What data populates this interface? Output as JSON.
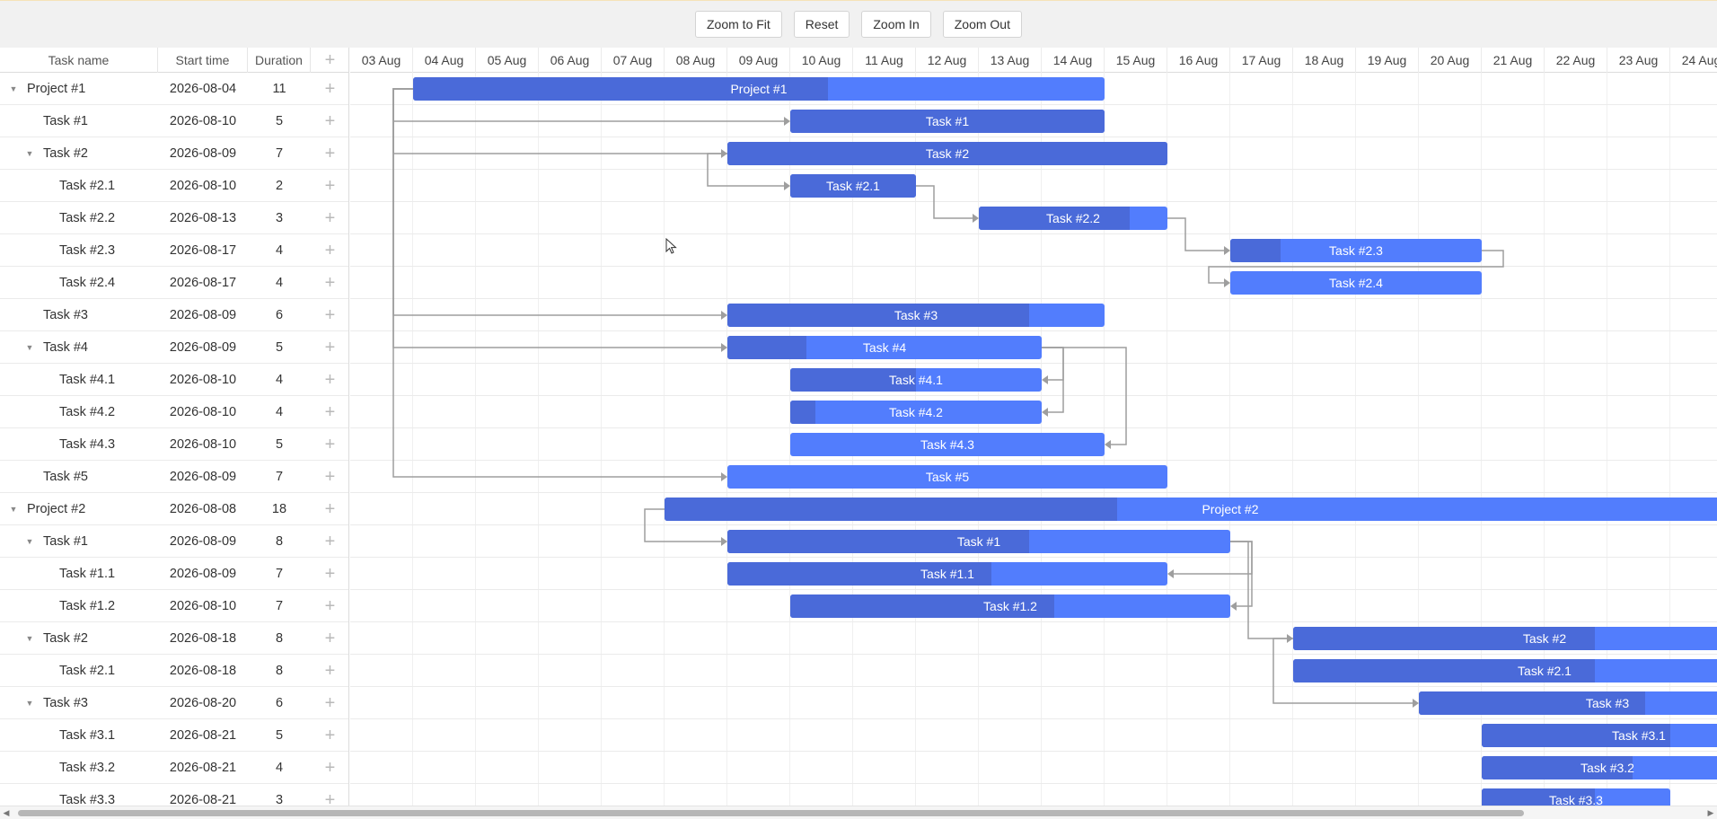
{
  "toolbar": {
    "buttons": [
      {
        "id": "zoom-to-fit",
        "label": "Zoom to Fit"
      },
      {
        "id": "reset",
        "label": "Reset"
      },
      {
        "id": "zoom-in",
        "label": "Zoom In"
      },
      {
        "id": "zoom-out",
        "label": "Zoom Out"
      }
    ]
  },
  "grid": {
    "columns": {
      "name": "Task name",
      "start": "Start time",
      "duration": "Duration",
      "add": "+"
    }
  },
  "scale": {
    "days": [
      "03 Aug",
      "04 Aug",
      "05 Aug",
      "06 Aug",
      "07 Aug",
      "08 Aug",
      "09 Aug",
      "10 Aug",
      "11 Aug",
      "12 Aug",
      "13 Aug",
      "14 Aug",
      "15 Aug",
      "16 Aug",
      "17 Aug",
      "18 Aug",
      "19 Aug",
      "20 Aug",
      "21 Aug",
      "22 Aug",
      "23 Aug",
      "24 Aug"
    ]
  },
  "tasks": [
    {
      "id": "p1",
      "name": "Project #1",
      "start": "2026-08-04",
      "duration": "11",
      "level": 0,
      "toggle": true,
      "bar_start": "2026-08-04",
      "bar_days": 11,
      "progress": 0.6
    },
    {
      "id": "p1t1",
      "name": "Task #1",
      "start": "2026-08-10",
      "duration": "5",
      "level": 1,
      "toggle": false,
      "bar_start": "2026-08-10",
      "bar_days": 5,
      "progress": 1.0
    },
    {
      "id": "p1t2",
      "name": "Task #2",
      "start": "2026-08-09",
      "duration": "7",
      "level": 1,
      "toggle": true,
      "bar_start": "2026-08-09",
      "bar_days": 7,
      "progress": 1.0
    },
    {
      "id": "p1t21",
      "name": "Task #2.1",
      "start": "2026-08-10",
      "duration": "2",
      "level": 2,
      "toggle": false,
      "bar_start": "2026-08-10",
      "bar_days": 2,
      "progress": 1.0
    },
    {
      "id": "p1t22",
      "name": "Task #2.2",
      "start": "2026-08-13",
      "duration": "3",
      "level": 2,
      "toggle": false,
      "bar_start": "2026-08-13",
      "bar_days": 3,
      "progress": 0.8
    },
    {
      "id": "p1t23",
      "name": "Task #2.3",
      "start": "2026-08-17",
      "duration": "4",
      "level": 2,
      "toggle": false,
      "bar_start": "2026-08-17",
      "bar_days": 4,
      "progress": 0.2
    },
    {
      "id": "p1t24",
      "name": "Task #2.4",
      "start": "2026-08-17",
      "duration": "4",
      "level": 2,
      "toggle": false,
      "bar_start": "2026-08-17",
      "bar_days": 4,
      "progress": 0
    },
    {
      "id": "p1t3",
      "name": "Task #3",
      "start": "2026-08-09",
      "duration": "6",
      "level": 1,
      "toggle": false,
      "bar_start": "2026-08-09",
      "bar_days": 6,
      "progress": 0.8
    },
    {
      "id": "p1t4",
      "name": "Task #4",
      "start": "2026-08-09",
      "duration": "5",
      "level": 1,
      "toggle": true,
      "bar_start": "2026-08-09",
      "bar_days": 5,
      "progress": 0.25
    },
    {
      "id": "p1t41",
      "name": "Task #4.1",
      "start": "2026-08-10",
      "duration": "4",
      "level": 2,
      "toggle": false,
      "bar_start": "2026-08-10",
      "bar_days": 4,
      "progress": 0.5
    },
    {
      "id": "p1t42",
      "name": "Task #4.2",
      "start": "2026-08-10",
      "duration": "4",
      "level": 2,
      "toggle": false,
      "bar_start": "2026-08-10",
      "bar_days": 4,
      "progress": 0.1
    },
    {
      "id": "p1t43",
      "name": "Task #4.3",
      "start": "2026-08-10",
      "duration": "5",
      "level": 2,
      "toggle": false,
      "bar_start": "2026-08-10",
      "bar_days": 5,
      "progress": 0
    },
    {
      "id": "p1t5",
      "name": "Task #5",
      "start": "2026-08-09",
      "duration": "7",
      "level": 1,
      "toggle": false,
      "bar_start": "2026-08-09",
      "bar_days": 7,
      "progress": 0
    },
    {
      "id": "p2",
      "name": "Project #2",
      "start": "2026-08-08",
      "duration": "18",
      "level": 0,
      "toggle": true,
      "bar_start": "2026-08-08",
      "bar_days": 18,
      "progress": 0.4
    },
    {
      "id": "p2t1",
      "name": "Task #1",
      "start": "2026-08-09",
      "duration": "8",
      "level": 1,
      "toggle": true,
      "bar_start": "2026-08-09",
      "bar_days": 8,
      "progress": 0.6
    },
    {
      "id": "p2t11",
      "name": "Task #1.1",
      "start": "2026-08-09",
      "duration": "7",
      "level": 2,
      "toggle": false,
      "bar_start": "2026-08-09",
      "bar_days": 7,
      "progress": 0.6
    },
    {
      "id": "p2t12",
      "name": "Task #1.2",
      "start": "2026-08-10",
      "duration": "7",
      "level": 2,
      "toggle": false,
      "bar_start": "2026-08-10",
      "bar_days": 7,
      "progress": 0.6
    },
    {
      "id": "p2t2",
      "name": "Task #2",
      "start": "2026-08-18",
      "duration": "8",
      "level": 1,
      "toggle": true,
      "bar_start": "2026-08-18",
      "bar_days": 8,
      "progress": 0.6
    },
    {
      "id": "p2t21",
      "name": "Task #2.1",
      "start": "2026-08-18",
      "duration": "8",
      "level": 2,
      "toggle": false,
      "bar_start": "2026-08-18",
      "bar_days": 8,
      "progress": 0.6
    },
    {
      "id": "p2t3",
      "name": "Task #3",
      "start": "2026-08-20",
      "duration": "6",
      "level": 1,
      "toggle": true,
      "bar_start": "2026-08-20",
      "bar_days": 6,
      "progress": 0.6
    },
    {
      "id": "p2t31",
      "name": "Task #3.1",
      "start": "2026-08-21",
      "duration": "5",
      "level": 2,
      "toggle": false,
      "bar_start": "2026-08-21",
      "bar_days": 5,
      "progress": 0.6
    },
    {
      "id": "p2t32",
      "name": "Task #3.2",
      "start": "2026-08-21",
      "duration": "4",
      "level": 2,
      "toggle": false,
      "bar_start": "2026-08-21",
      "bar_days": 4,
      "progress": 0.6
    },
    {
      "id": "p2t33",
      "name": "Task #3.3",
      "start": "2026-08-21",
      "duration": "3",
      "level": 2,
      "toggle": false,
      "bar_start": "2026-08-21",
      "bar_days": 3,
      "progress": 0.6
    }
  ],
  "links": [
    {
      "from": "p1",
      "to": "p1t1",
      "type": "start-to-start"
    },
    {
      "from": "p1",
      "to": "p1t2",
      "type": "start-to-start"
    },
    {
      "from": "p1",
      "to": "p1t3",
      "type": "start-to-start"
    },
    {
      "from": "p1",
      "to": "p1t4",
      "type": "start-to-start"
    },
    {
      "from": "p1",
      "to": "p1t5",
      "type": "start-to-start"
    },
    {
      "from": "p1t2",
      "to": "p1t21",
      "type": "start-to-start"
    },
    {
      "from": "p1t21",
      "to": "p1t22",
      "type": "finish-to-start"
    },
    {
      "from": "p1t22",
      "to": "p1t23",
      "type": "finish-to-start"
    },
    {
      "from": "p1t23",
      "to": "p1t24",
      "type": "finish-to-start"
    },
    {
      "from": "p1t4",
      "to": "p1t41",
      "type": "finish-to-finish"
    },
    {
      "from": "p1t4",
      "to": "p1t42",
      "type": "finish-to-finish"
    },
    {
      "from": "p1t4",
      "to": "p1t43",
      "type": "finish-to-finish"
    },
    {
      "from": "p2",
      "to": "p2t1",
      "type": "start-to-start"
    },
    {
      "from": "p2t1",
      "to": "p2t11",
      "type": "finish-to-finish"
    },
    {
      "from": "p2t1",
      "to": "p2t12",
      "type": "finish-to-finish"
    },
    {
      "from": "p2t1",
      "to": "p2t2",
      "type": "finish-to-start"
    },
    {
      "from": "p2t2",
      "to": "p2t3",
      "type": "start-to-start"
    }
  ],
  "colors": {
    "bar": "#527dfd",
    "bar_progress": "#4a6ad9",
    "link": "#9e9e9e",
    "toolbar_bg": "#f1f1f1"
  }
}
